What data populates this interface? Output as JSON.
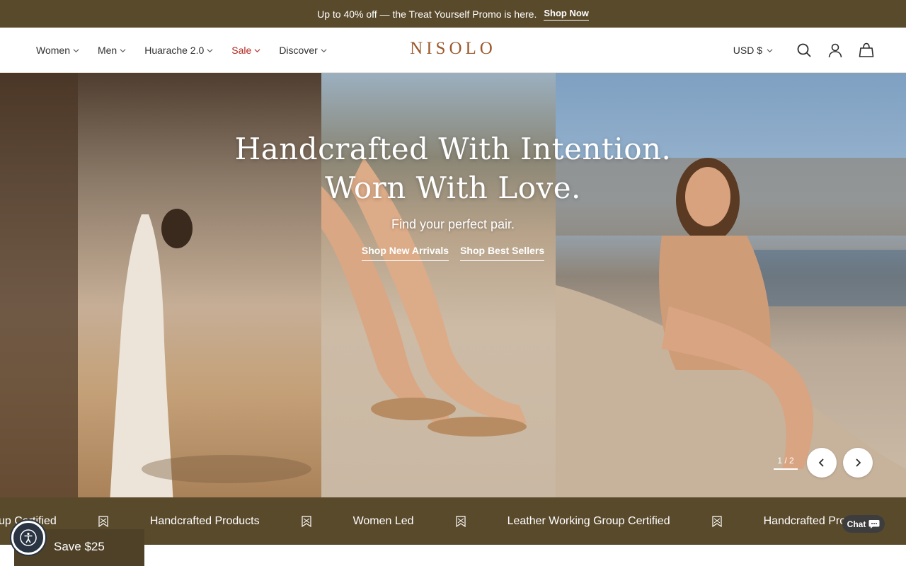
{
  "announcement": {
    "text": "Up to 40% off — the Treat Yourself Promo is here.",
    "link": "Shop Now"
  },
  "header": {
    "nav": [
      "Women",
      "Men",
      "Huarache 2.0",
      "Sale",
      "Discover"
    ],
    "logo": "NISOLO",
    "currency": "USD $",
    "icons": [
      "search-icon",
      "account-icon",
      "cart-icon"
    ]
  },
  "hero": {
    "title_line1": "Handcrafted With Intention.",
    "title_line2": "Worn With Love.",
    "subtitle": "Find your perfect pair.",
    "links": [
      "Shop New Arrivals",
      "Shop Best Sellers"
    ],
    "slide_counter": "1 / 2"
  },
  "marquee": {
    "items": [
      "up Certified",
      "Handcrafted Products",
      "Women Led",
      "Leather Working Group Certified",
      "Handcrafted Pro"
    ]
  },
  "save_badge": "Save $25",
  "chat": "Chat",
  "colors": {
    "brand_brown": "#5a4a2c",
    "logo": "#9c5a2c",
    "sale": "#b3261e"
  }
}
